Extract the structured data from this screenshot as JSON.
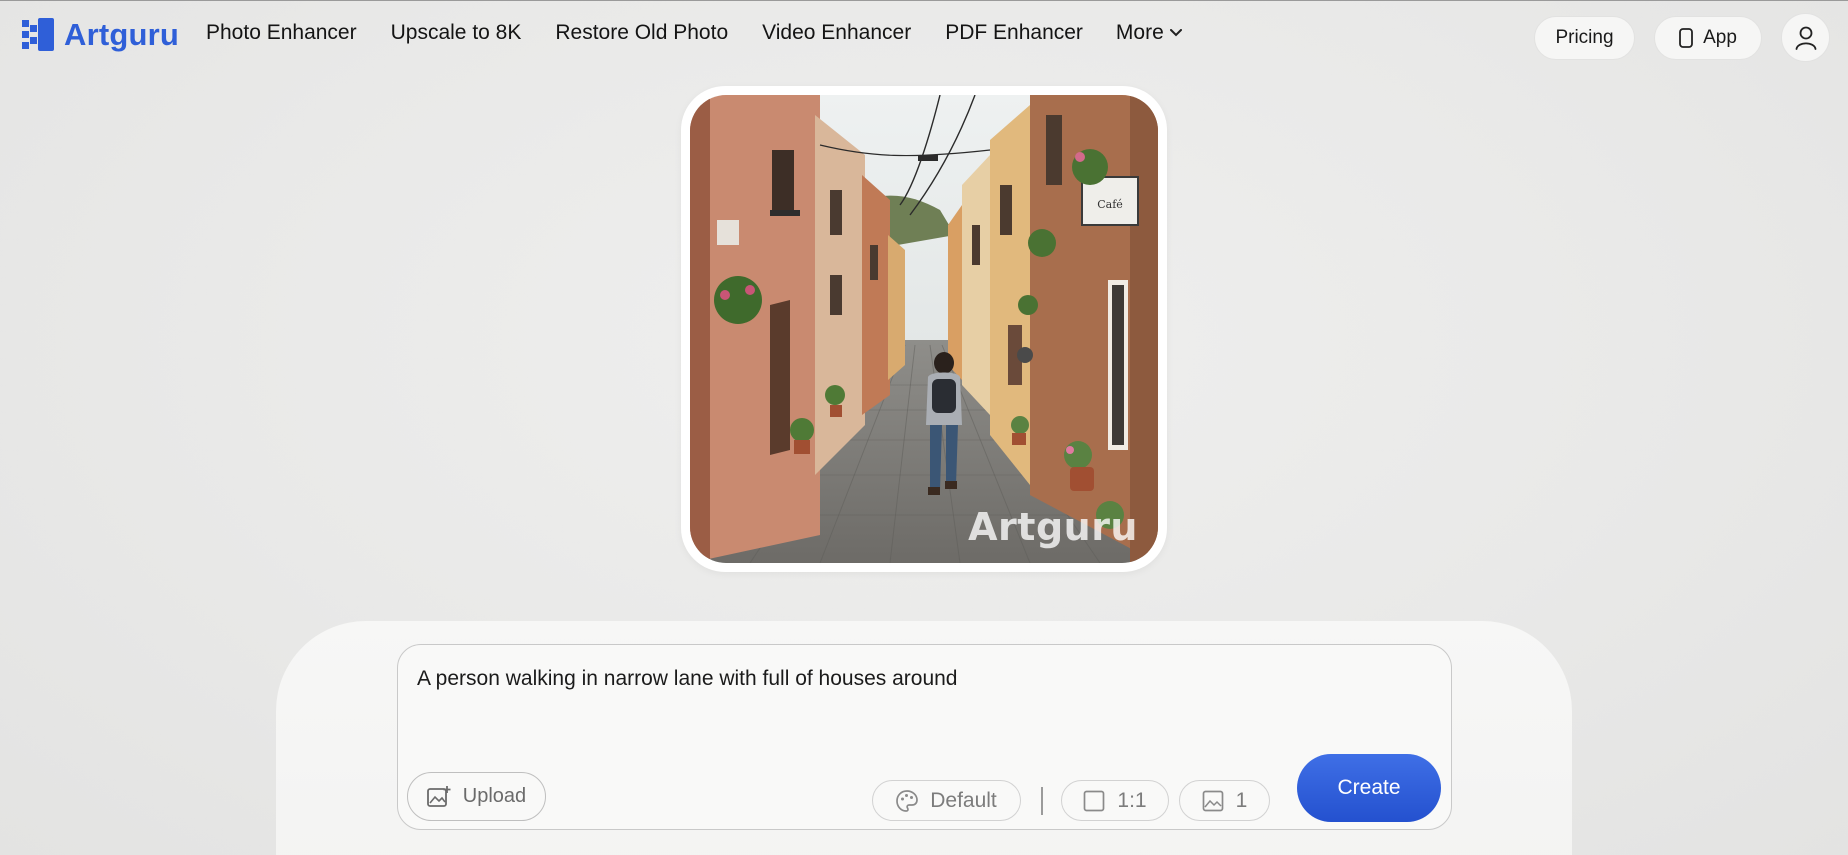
{
  "brand": {
    "name": "Artguru",
    "accent": "#2f5fd8"
  },
  "nav": {
    "items": [
      {
        "label": "Photo Enhancer"
      },
      {
        "label": "Upscale to 8K"
      },
      {
        "label": "Restore Old Photo"
      },
      {
        "label": "Video Enhancer"
      },
      {
        "label": "PDF Enhancer"
      },
      {
        "label": "More",
        "icon": "chevron-down-icon"
      }
    ]
  },
  "header_actions": {
    "pricing_label": "Pricing",
    "app_label": "App",
    "app_icon": "phone-icon",
    "user_icon": "user-icon"
  },
  "preview": {
    "watermark": "Artguru",
    "sign_text": "Café"
  },
  "composer": {
    "prompt": "A person walking in narrow lane with full of houses around",
    "upload_label": "Upload",
    "style_label": "Default",
    "ratio_label": "1:1",
    "count_label": "1",
    "create_label": "Create",
    "create_color": "#2d5bdb"
  }
}
